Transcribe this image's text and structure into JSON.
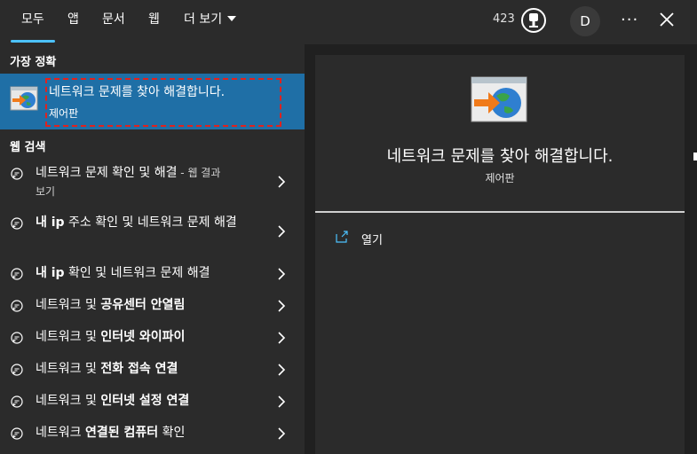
{
  "tabs": [
    {
      "label": "모두",
      "active": true
    },
    {
      "label": "앱"
    },
    {
      "label": "문서"
    },
    {
      "label": "웹"
    },
    {
      "label": "더 보기"
    }
  ],
  "header": {
    "points": "423",
    "avatar_initial": "D",
    "more_label": "···",
    "reward_icon": "reward-medal-icon",
    "close_icon": "close-icon"
  },
  "best_match": {
    "section_label": "가장 정확",
    "title": "네트워크 문제를 찾아 해결합니다.",
    "subtitle": "제어판",
    "icon": "network-troubleshoot-icon"
  },
  "web_search": {
    "section_label": "웹 검색",
    "items": [
      {
        "bold": "",
        "text": "네트워크 문제 확인 및 해결",
        "suffix": " - 웹 결과",
        "line2": "보기"
      },
      {
        "bold": "내 ip",
        "text": " 주소 확인 및 네트워크 문제 해결",
        "suffix": "",
        "line2": ""
      },
      {
        "bold": "내 ip",
        "text": " 확인 및 네트워크 문제 해결",
        "suffix": "",
        "line2": ""
      },
      {
        "bold": "",
        "text": "네트워크 및 ",
        "bold2": "공유센터 안열림"
      },
      {
        "bold": "",
        "text": "네트워크 및 ",
        "bold2": "인터넷 와이파이"
      },
      {
        "bold": "",
        "text": "네트워크 및 ",
        "bold2": "전화 접속 연결"
      },
      {
        "bold": "",
        "text": "네트워크 및 ",
        "bold2": "인터넷 설정 연결"
      },
      {
        "bold": "",
        "text": "네트워크 ",
        "bold2": "연결된 컴퓨터",
        "tail": " 확인"
      }
    ]
  },
  "preview": {
    "title": "네트워크 문제를 찾아 해결합니다.",
    "subtitle": "제어판",
    "open_label": "열기",
    "open_icon": "open-external-icon"
  },
  "colors": {
    "accent": "#4cc2ff",
    "selection": "#1f6fa6",
    "focus_outline": "#e0221e",
    "panel": "#2b2b2b",
    "background": "#202020"
  }
}
